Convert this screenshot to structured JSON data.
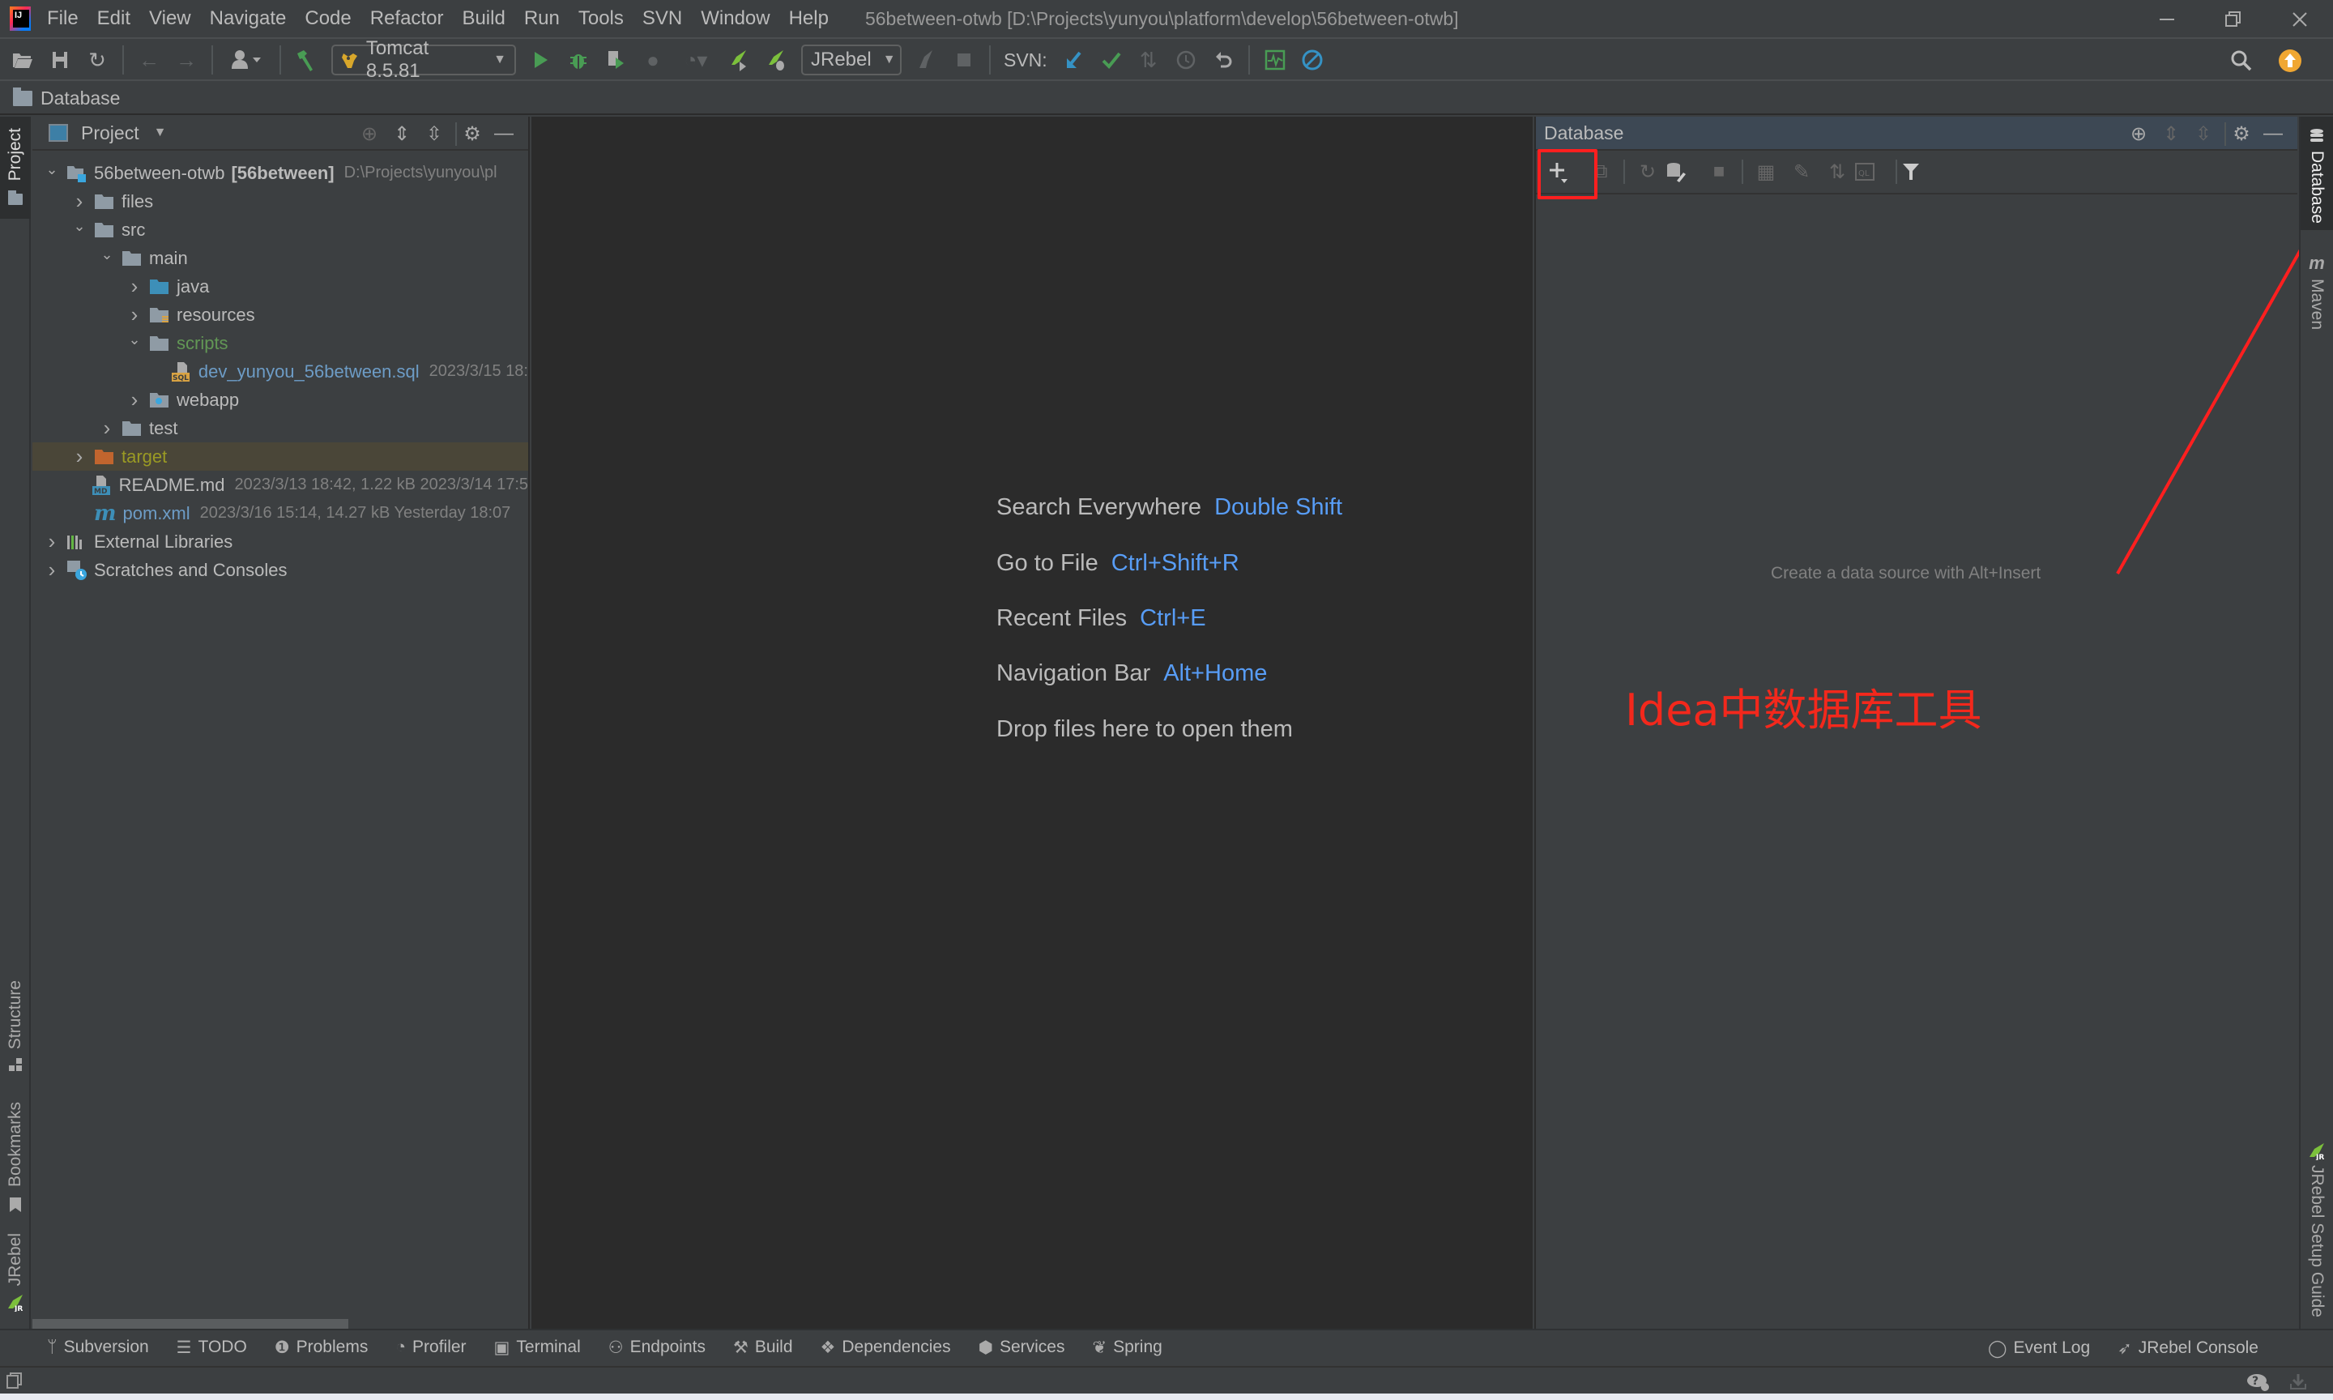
{
  "menubar": {
    "items": [
      "File",
      "Edit",
      "View",
      "Navigate",
      "Code",
      "Refactor",
      "Build",
      "Run",
      "Tools",
      "SVN",
      "Window",
      "Help"
    ],
    "mnemonics": [
      "F",
      "E",
      "V",
      "N",
      "C",
      "R",
      "B",
      "u",
      "T",
      "S",
      "W",
      "H"
    ],
    "window_title": "56between-otwb [D:\\Projects\\yunyou\\platform\\develop\\56between-otwb]",
    "window_controls": [
      "minimize",
      "restore",
      "close"
    ]
  },
  "toolbar": {
    "run_config": "Tomcat 8.5.81",
    "jrebel_config": "JRebel",
    "svn_label": "SVN:",
    "icons": [
      "open-folder",
      "save-all",
      "synchronize",
      "back",
      "forward",
      "vcs-user",
      "build-hammer",
      "run",
      "debug",
      "run-with-coverage",
      "profile",
      "attach-profiler",
      "jrebel-run",
      "jrebel-debug",
      "jrebel-rocket",
      "stop",
      "svn-update",
      "svn-commit",
      "svn-compare",
      "svn-history",
      "svn-rollback",
      "performance-monitor",
      "power-save",
      "search",
      "update-available"
    ]
  },
  "navbar": {
    "breadcrumb": "Database"
  },
  "left_stripe": {
    "tabs": [
      "Project",
      "Structure",
      "Bookmarks",
      "JRebel"
    ]
  },
  "project_panel": {
    "title": "Project",
    "header_icons": [
      "locate",
      "expand-all",
      "collapse-all",
      "settings",
      "hide"
    ],
    "tree": [
      {
        "label": "56between-otwb",
        "bold_suffix": "[56between]",
        "meta": "D:\\Projects\\yunyou\\pl",
        "depth": 0,
        "expanded": true,
        "icon": "module"
      },
      {
        "label": "files",
        "depth": 1,
        "expanded": false,
        "icon": "folder"
      },
      {
        "label": "src",
        "depth": 1,
        "expanded": true,
        "icon": "folder"
      },
      {
        "label": "main",
        "depth": 2,
        "expanded": true,
        "icon": "folder"
      },
      {
        "label": "java",
        "depth": 3,
        "expanded": false,
        "icon": "source-folder"
      },
      {
        "label": "resources",
        "depth": 3,
        "expanded": false,
        "icon": "resources-folder"
      },
      {
        "label": "scripts",
        "depth": 3,
        "expanded": true,
        "icon": "folder",
        "color": "green"
      },
      {
        "label": "dev_yunyou_56between.sql",
        "meta": "2023/3/15 18:",
        "depth": 4,
        "icon": "sql-file",
        "color": "blue"
      },
      {
        "label": "webapp",
        "depth": 3,
        "expanded": false,
        "icon": "web-folder"
      },
      {
        "label": "test",
        "depth": 2,
        "expanded": false,
        "icon": "folder"
      },
      {
        "label": "target",
        "depth": 1,
        "expanded": false,
        "icon": "excluded-folder",
        "color": "olive",
        "selected": true
      },
      {
        "label": "README.md",
        "meta": "2023/3/13 18:42, 1.22 kB 2023/3/14 17:5",
        "depth": 1,
        "icon": "md-file"
      },
      {
        "label": "pom.xml",
        "meta": "2023/3/16 15:14, 14.27 kB Yesterday 18:07",
        "depth": 1,
        "icon": "maven-file",
        "color": "blue"
      },
      {
        "label": "External Libraries",
        "depth": 0,
        "expanded": false,
        "icon": "libraries"
      },
      {
        "label": "Scratches and Consoles",
        "depth": 0,
        "expanded": false,
        "icon": "scratches"
      }
    ]
  },
  "editor": {
    "hints": [
      {
        "text": "Search Everywhere",
        "key": "Double Shift"
      },
      {
        "text": "Go to File",
        "key": "Ctrl+Shift+R"
      },
      {
        "text": "Recent Files",
        "key": "Ctrl+E"
      },
      {
        "text": "Navigation Bar",
        "key": "Alt+Home"
      },
      {
        "text": "Drop files here to open them",
        "key": ""
      }
    ]
  },
  "database_panel": {
    "title": "Database",
    "header_icons": [
      "locate",
      "expand-all",
      "collapse-all",
      "settings",
      "hide"
    ],
    "toolbar_icons": [
      "new-data-source",
      "duplicate",
      "refresh",
      "db-properties",
      "stop",
      "table-view",
      "edit",
      "compare",
      "jump-to-console",
      "filter"
    ],
    "empty_text": "Create a data source with Alt+Insert",
    "annotation": "Idea中数据库工具",
    "annotation_color": "#f3281c"
  },
  "right_stripe": {
    "tabs": [
      "Database",
      "Maven",
      "JRebel Setup Guide"
    ]
  },
  "bottom_bar": {
    "left_tabs": [
      {
        "label": "Subversion",
        "icon": "subversion-icon",
        "glyph": "ᛘ"
      },
      {
        "label": "TODO",
        "icon": "todo-icon",
        "glyph": "☰"
      },
      {
        "label": "Problems",
        "icon": "problems-icon",
        "glyph": "❶"
      },
      {
        "label": "Profiler",
        "icon": "profiler-icon",
        "glyph": "◔"
      },
      {
        "label": "Terminal",
        "icon": "terminal-icon",
        "glyph": "▣"
      },
      {
        "label": "Endpoints",
        "icon": "endpoints-icon",
        "glyph": "⚇"
      },
      {
        "label": "Build",
        "icon": "build-icon",
        "glyph": "⚒"
      },
      {
        "label": "Dependencies",
        "icon": "dependencies-icon",
        "glyph": "❖"
      },
      {
        "label": "Services",
        "icon": "services-icon",
        "glyph": "⬢"
      },
      {
        "label": "Spring",
        "icon": "spring-icon",
        "glyph": "❦"
      }
    ],
    "right_tabs": [
      {
        "label": "Event Log",
        "icon": "event-log-icon",
        "glyph": "◯"
      },
      {
        "label": "JRebel Console",
        "icon": "jrebel-console-icon",
        "glyph": "➶"
      }
    ]
  },
  "colors": {
    "accent_key": "#589df6",
    "annotation_red": "#ff1f1f",
    "update_badge": "#f0a732"
  }
}
